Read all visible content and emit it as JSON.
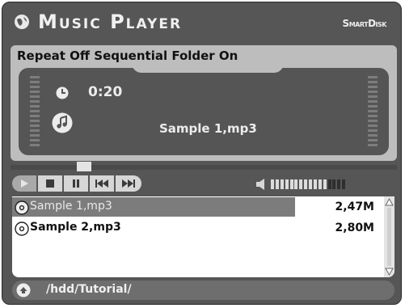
{
  "app": {
    "title": "Music Player",
    "brand": "SmartDisk",
    "logo_icon": "globe-logo-icon"
  },
  "status_bar": {
    "text": "Repeat Off Sequential Folder On"
  },
  "now_playing": {
    "elapsed": "0:20",
    "track": "Sample 1,mp3"
  },
  "seek": {
    "position_fraction": 0.19
  },
  "controls": [
    {
      "name": "play-button",
      "icon": "play-icon"
    },
    {
      "name": "stop-button",
      "icon": "stop-icon"
    },
    {
      "name": "pause-button",
      "icon": "pause-icon"
    },
    {
      "name": "previous-button",
      "icon": "previous-icon"
    },
    {
      "name": "next-button",
      "icon": "next-icon"
    }
  ],
  "volume": {
    "icon": "speaker-icon",
    "level_fraction": 0.75,
    "segments": 16
  },
  "file_list": [
    {
      "name": "Sample 1,mp3",
      "size": "2,47M",
      "selected": true,
      "icon": "cd-icon"
    },
    {
      "name": "Sample 2,mp3",
      "size": "2,80M",
      "selected": false,
      "icon": "cd-icon"
    }
  ],
  "path_bar": {
    "path": "/hdd/Tutorial/",
    "icon": "up-folder-icon"
  },
  "colors": {
    "frame": "#565656",
    "panel": "#bdbdbd",
    "display": "#555555",
    "highlight": "#7c7c7c"
  }
}
